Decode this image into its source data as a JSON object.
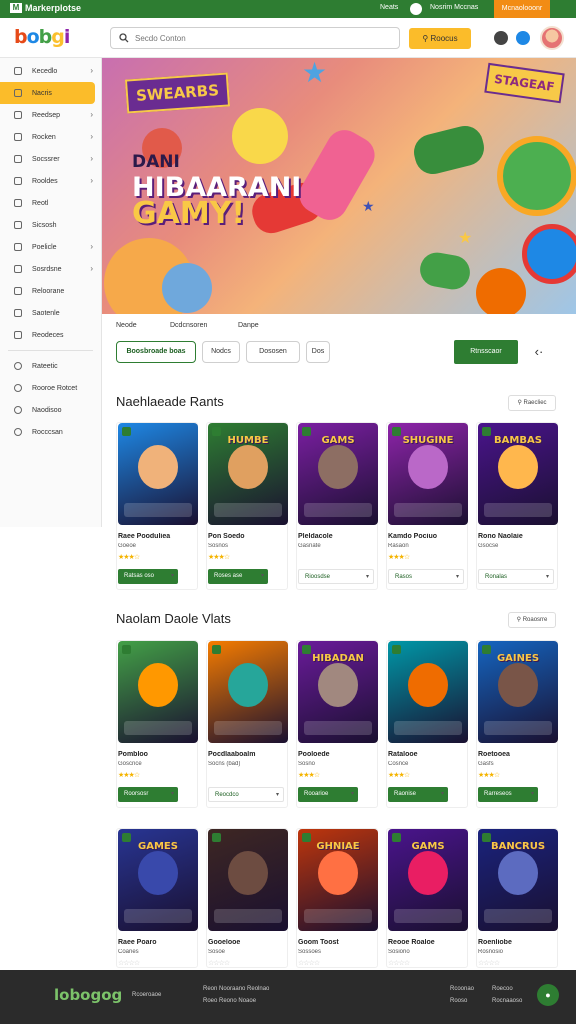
{
  "topbar": {
    "brand": "Markerplotse",
    "links": [
      "Neats",
      "Nosrim Mccnas"
    ],
    "cta": "Mcnaolooonr"
  },
  "header": {
    "logo_letters": [
      "b",
      "o",
      "b",
      "g",
      "i"
    ],
    "search_placeholder": "Secdo Conton",
    "search_button": "Roocus"
  },
  "sidebar": {
    "items": [
      {
        "label": "Kecedlo",
        "icon": "grid-icon",
        "chevron": true
      },
      {
        "label": "Nacris",
        "icon": "fire-icon",
        "chevron": false,
        "active": true
      },
      {
        "label": "Reedsep",
        "icon": "folder-icon",
        "chevron": true
      },
      {
        "label": "Rocken",
        "icon": "play-icon",
        "chevron": true
      },
      {
        "label": "Socssrer",
        "icon": "gamepad-icon",
        "chevron": true
      },
      {
        "label": "Rooldes",
        "icon": "puzzle-icon",
        "chevron": true
      },
      {
        "label": "Reotl",
        "icon": "tag-icon",
        "chevron": false
      },
      {
        "label": "Sicsosh",
        "icon": "search-icon",
        "chevron": false
      },
      {
        "label": "Poelicle",
        "icon": "book-icon",
        "chevron": true
      },
      {
        "label": "Sosrdsne",
        "icon": "globe-icon",
        "chevron": true
      },
      {
        "label": "Reloorane",
        "icon": "edit-icon",
        "chevron": false
      },
      {
        "label": "Saotenle",
        "icon": "list-icon",
        "chevron": false
      },
      {
        "label": "Reodeces",
        "icon": "chart-icon",
        "chevron": false
      }
    ],
    "items2": [
      {
        "label": "Rateetic",
        "icon": "doc-icon"
      },
      {
        "label": "Rooroe Rotcet",
        "icon": "shield-icon"
      },
      {
        "label": "Naodisoo",
        "icon": "star-icon"
      },
      {
        "label": "Rocccsan",
        "icon": "info-icon"
      }
    ]
  },
  "hero": {
    "badge": "SWEARBS",
    "line1": "DANI",
    "line2": "HIBAARANI",
    "line3": "GAMY!",
    "badge2": "STAGEAF"
  },
  "filters": {
    "tabs": [
      "Neode",
      "Dcdcnsoren",
      "Danpe"
    ],
    "chips": [
      "Boosbroade boas",
      "Nodcs",
      "Dososen",
      "Dos"
    ],
    "action": "Rtnsscaor"
  },
  "section1": {
    "title": "Naehlaeade Rants",
    "see_all": "Raecliec",
    "cards": [
      {
        "t1": "Raee Pooduliea",
        "t2": "Goeoe",
        "rating": 3,
        "btn": "Ratsas oso",
        "style": "filled",
        "hue": "#1e88e5",
        "face": "#f0b27a",
        "label": ""
      },
      {
        "t1": "Pon Soedo",
        "t2": "Sosnos",
        "rating": 3,
        "btn": "Roses ase",
        "style": "filled",
        "hue": "#2e7d32",
        "face": "#e0a060",
        "label": "HUMBE"
      },
      {
        "t1": "Pleldacole",
        "t2": "Gasnate",
        "rating": 0,
        "btn": "Rioosdse",
        "style": "outline",
        "hue": "#7b1fa2",
        "face": "#8d6e63",
        "label": "GAMS"
      },
      {
        "t1": "Kamdo Pociuo",
        "t2": "Rasaon",
        "rating": 3,
        "btn": "Rasos",
        "style": "outline",
        "hue": "#8e24aa",
        "face": "#ba68c8",
        "label": "SHUGINE"
      },
      {
        "t1": "Rono Naolaie",
        "t2": "Gsocse",
        "rating": 0,
        "btn": "Ronalas",
        "style": "outline",
        "hue": "#4a148c",
        "face": "#ffb74d",
        "label": "BAMBAS"
      }
    ]
  },
  "section2": {
    "title": "Naolam Daole Vlats",
    "see_all": "Roaosrre",
    "cards": [
      {
        "t1": "Pombloo",
        "t2": "Goscnce",
        "rating": 3,
        "btn": "Roorsosr",
        "style": "filled",
        "hue": "#43a047",
        "face": "#ff9800",
        "label": ""
      },
      {
        "t1": "Pocdlaaboalm",
        "t2": "Socns (bad)",
        "rating": 0,
        "btn": "Reocdco",
        "style": "outline",
        "hue": "#f57c00",
        "face": "#26a69a",
        "label": ""
      },
      {
        "t1": "Pooloede",
        "t2": "Sosno",
        "rating": 3,
        "btn": "Rooarioe",
        "style": "filled",
        "hue": "#6a1b9a",
        "face": "#a1887f",
        "label": "HIBADAN"
      },
      {
        "t1": "Ratalooe",
        "t2": "Cosnce",
        "rating": 3,
        "btn": "Raonise",
        "style": "filled",
        "hue": "#0097a7",
        "face": "#ef6c00",
        "label": ""
      },
      {
        "t1": "Roetooea",
        "t2": "Gasfs",
        "rating": 3,
        "btn": "Rarreseos",
        "style": "filled",
        "hue": "#1565c0",
        "face": "#795548",
        "label": "GAINES"
      }
    ]
  },
  "section3": {
    "cards": [
      {
        "t1": "Raee Poaro",
        "t2": "Coanes",
        "hue": "#283593",
        "face": "#3949ab",
        "label": "GAMES"
      },
      {
        "t1": "Gooelooe",
        "t2": "Sosoe",
        "hue": "#3e2723",
        "face": "#6d4c41",
        "label": ""
      },
      {
        "t1": "Goom Toost",
        "t2": "Sossoes",
        "hue": "#bf360c",
        "face": "#ff7043",
        "label": "GHNIAE"
      },
      {
        "t1": "Reooe Roaloe",
        "t2": "Sosiorio",
        "hue": "#4a148c",
        "face": "#e91e63",
        "label": "GAMS"
      },
      {
        "t1": "Roenliobe",
        "t2": "Rosnosio",
        "hue": "#1a237e",
        "face": "#5c6bc0",
        "label": "BANCRUS"
      }
    ]
  },
  "footer": {
    "logo": "lobogog",
    "tagline": "Rcoeroaoe",
    "mid1": "Reon Nooraano Reolnao",
    "mid2": "Roeo Reono Noaoe",
    "right1a": "Rcoonao",
    "right1b": "Roecoo",
    "right2a": "Rooso",
    "right2b": "Rocnaaoso"
  },
  "colors": {
    "brand_green": "#2e7d32",
    "accent_orange": "#f28c14",
    "accent_yellow": "#fbbc2a"
  }
}
